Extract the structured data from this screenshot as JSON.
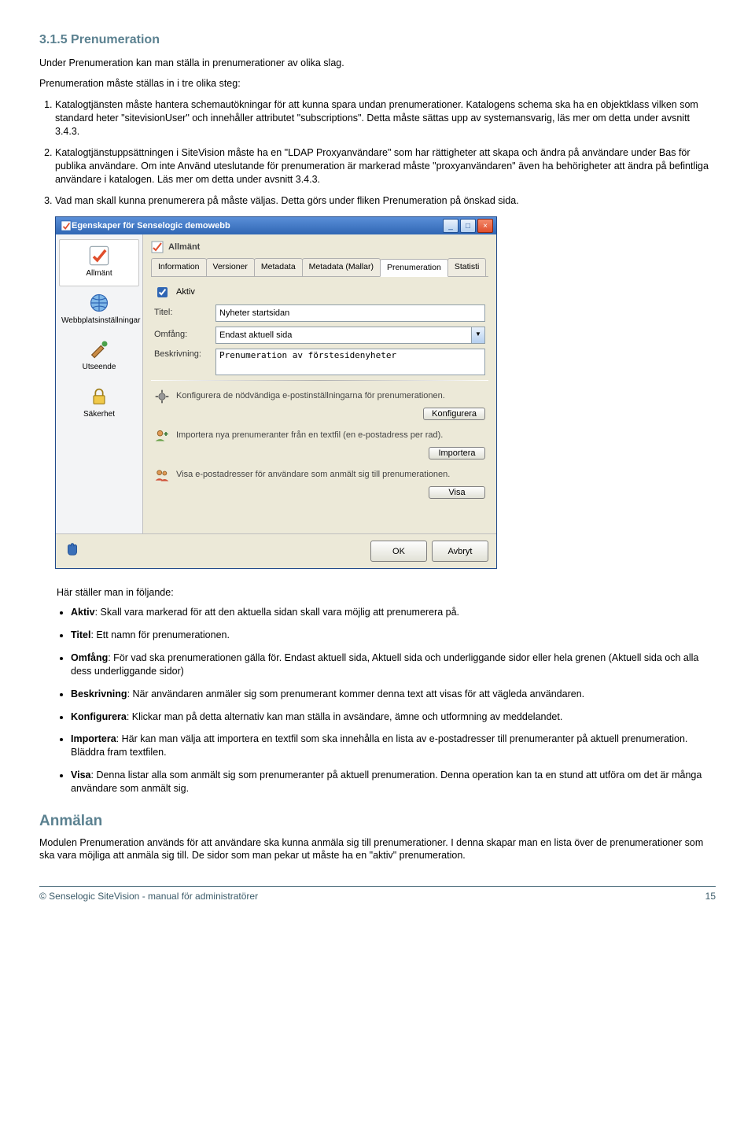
{
  "section": {
    "number": "3.1.5",
    "title": "Prenumeration",
    "intro_line": "Under Prenumeration kan man ställa in prenumerationer av olika slag.",
    "intro_line2": "Prenumeration måste ställas in i tre olika steg:",
    "steps": [
      "Katalogtjänsten måste hantera schemautökningar för att kunna spara undan prenumerationer. Katalogens schema ska ha en objektklass vilken som standard heter \"sitevisionUser\" och innehåller attributet \"subscriptions\". Detta måste sättas upp av systemansvarig, läs mer om detta under avsnitt 3.4.3.",
      "Katalogtjänstuppsättningen i SiteVision måste ha en \"LDAP Proxyanvändare\" som har rättigheter att skapa och ändra på användare under Bas för publika användare. Om inte Använd uteslutande för prenumeration är markerad måste \"proxyanvändaren\" även ha behörigheter att ändra på befintliga användare i katalogen. Läs mer om detta under avsnitt 3.4.3.",
      "Vad man skall kunna prenumerera på måste väljas. Detta görs under fliken Prenumeration på önskad sida."
    ]
  },
  "dialog": {
    "title_prefix": "Egenskaper för",
    "title_site": "Senselogic demowebb",
    "sidebar": [
      {
        "label": "Allmänt"
      },
      {
        "label": "Webbplatsinställningar"
      },
      {
        "label": "Utseende"
      },
      {
        "label": "Säkerhet"
      }
    ],
    "panel_title": "Allmänt",
    "tabs": [
      "Information",
      "Versioner",
      "Metadata",
      "Metadata (Mallar)",
      "Prenumeration",
      "Statisti"
    ],
    "active_tab_index": 4,
    "aktiv_label": "Aktiv",
    "titel_label": "Titel:",
    "titel_value": "Nyheter startsidan",
    "omfang_label": "Omfång:",
    "omfang_value": "Endast aktuell sida",
    "beskrivning_label": "Beskrivning:",
    "beskrivning_value": "Prenumeration av förstesidenyheter",
    "rows": [
      {
        "text": "Konfigurera de nödvändiga e-postinställningarna för prenumerationen.",
        "button": "Konfigurera"
      },
      {
        "text": "Importera nya prenumeranter från en textfil (en e-postadress per rad).",
        "button": "Importera"
      },
      {
        "text": "Visa e-postadresser för användare som anmält sig till prenumerationen.",
        "button": "Visa"
      }
    ],
    "ok": "OK",
    "cancel": "Avbryt"
  },
  "after": {
    "intro": "Här ställer man in följande:",
    "items": [
      {
        "label": "Aktiv",
        "text": ": Skall vara markerad för att den aktuella sidan skall vara möjlig att prenumerera på."
      },
      {
        "label": "Titel",
        "text": ": Ett namn för prenumerationen."
      },
      {
        "label": "Omfång",
        "text": ": För vad ska prenumerationen gälla för. Endast aktuell sida, Aktuell sida och underliggande sidor eller hela grenen (Aktuell sida och alla dess underliggande sidor)"
      },
      {
        "label": "Beskrivning",
        "text": ": När användaren anmäler sig som prenumerant kommer denna text att visas för att vägleda användaren."
      },
      {
        "label": "Konfigurera",
        "text": ": Klickar man på detta alternativ kan man ställa in avsändare, ämne och utformning av meddelandet."
      },
      {
        "label": "Importera",
        "text": ": Här kan man välja att importera en textfil som ska innehålla en lista av e-postadresser till prenumeranter på aktuell prenumeration. Bläddra fram textfilen."
      },
      {
        "label": "Visa",
        "text": ": Denna listar alla som anmält sig som prenumeranter på aktuell prenumeration. Denna operation kan ta en stund att utföra om det är många användare som anmält sig."
      }
    ]
  },
  "anmalan": {
    "title": "Anmälan",
    "body": "Modulen Prenumeration används för att användare ska kunna anmäla sig till prenumerationer. I denna skapar man en lista över de prenumerationer som ska vara möjliga att anmäla sig till. De sidor som man pekar ut måste ha en \"aktiv\" prenumeration."
  },
  "footer": {
    "copyright": "© Senselogic SiteVision - manual för administratörer",
    "page": "15"
  }
}
